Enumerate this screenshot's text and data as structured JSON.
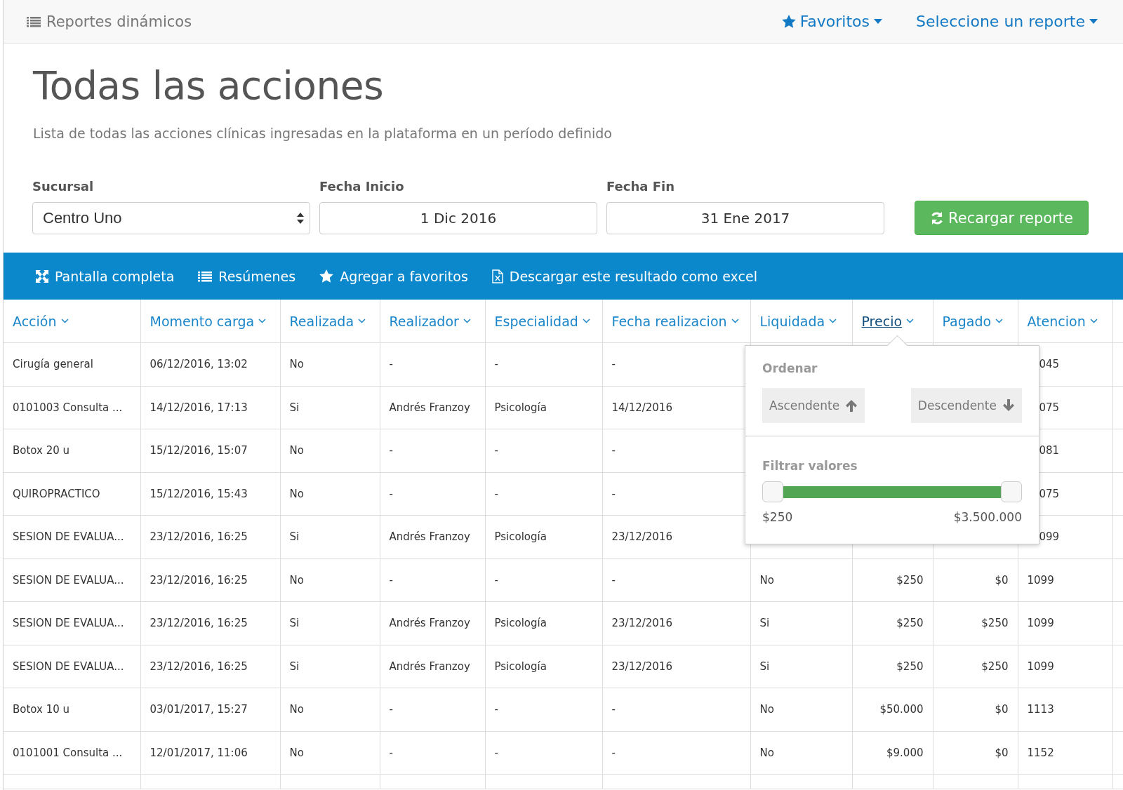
{
  "topbar": {
    "title": "Reportes dinámicos",
    "menus": [
      {
        "kind": "favorites",
        "label": "Favoritos"
      },
      {
        "kind": "reports",
        "label": "Seleccione un reporte"
      }
    ]
  },
  "header": {
    "title": "Todas las acciones",
    "subtitle": "Lista de todas las acciones clínicas ingresadas en la plataforma en un período definido"
  },
  "filters": [
    {
      "kind": "select",
      "label": "Sucursal",
      "value": "Centro Uno"
    },
    {
      "kind": "date",
      "label": "Fecha Inicio",
      "value": "1 Dic 2016"
    },
    {
      "kind": "date",
      "label": "Fecha Fin",
      "value": "31 Ene 2017"
    }
  ],
  "reload_button": "Recargar reporte",
  "toolbar": [
    {
      "kind": "fullscreen",
      "label": "Pantalla completa"
    },
    {
      "kind": "list",
      "label": "Resúmenes"
    },
    {
      "kind": "star",
      "label": "Agregar a favoritos"
    },
    {
      "kind": "excel",
      "label": "Descargar este resultado como excel"
    }
  ],
  "table": {
    "columns": [
      {
        "kind": "text",
        "label": "Acción",
        "selected": false
      },
      {
        "kind": "text",
        "label": "Momento carga",
        "selected": false
      },
      {
        "kind": "text",
        "label": "Realizada",
        "selected": false
      },
      {
        "kind": "text",
        "label": "Realizador",
        "selected": false
      },
      {
        "kind": "text",
        "label": "Especialidad",
        "selected": false
      },
      {
        "kind": "text",
        "label": "Fecha realizacion",
        "selected": false
      },
      {
        "kind": "text",
        "label": "Liquidada",
        "selected": false
      },
      {
        "kind": "money",
        "label": "Precio",
        "selected": true
      },
      {
        "kind": "money",
        "label": "Pagado",
        "selected": false
      },
      {
        "kind": "text",
        "label": "Atencion",
        "selected": false
      }
    ],
    "rows": [
      {
        "kind": "covered",
        "cells": [
          "Cirugía general",
          "06/12/2016, 13:02",
          "No",
          "-",
          "-",
          "-",
          "045"
        ]
      },
      {
        "kind": "covered",
        "cells": [
          "0101003 Consulta ...",
          "14/12/2016, 17:13",
          "Si",
          "Andrés Franzoy",
          "Psicología",
          "14/12/2016",
          "075"
        ]
      },
      {
        "kind": "covered",
        "cells": [
          "Botox 20 u",
          "15/12/2016, 15:07",
          "No",
          "-",
          "-",
          "-",
          "081"
        ]
      },
      {
        "kind": "covered",
        "cells": [
          "QUIROPRACTICO",
          "15/12/2016, 15:43",
          "No",
          "-",
          "-",
          "-",
          "075"
        ]
      },
      {
        "kind": "covered",
        "cells": [
          "SESION DE EVALUA...",
          "23/12/2016, 16:25",
          "Si",
          "Andrés Franzoy",
          "Psicología",
          "23/12/2016",
          "099"
        ]
      },
      {
        "kind": "full",
        "cells": [
          "SESION DE EVALUA...",
          "23/12/2016, 16:25",
          "No",
          "-",
          "-",
          "-",
          "No",
          "$250",
          "$0",
          "1099"
        ]
      },
      {
        "kind": "full",
        "cells": [
          "SESION DE EVALUA...",
          "23/12/2016, 16:25",
          "Si",
          "Andrés Franzoy",
          "Psicología",
          "23/12/2016",
          "Si",
          "$250",
          "$250",
          "1099"
        ]
      },
      {
        "kind": "full",
        "cells": [
          "SESION DE EVALUA...",
          "23/12/2016, 16:25",
          "Si",
          "Andrés Franzoy",
          "Psicología",
          "23/12/2016",
          "Si",
          "$250",
          "$250",
          "1099"
        ]
      },
      {
        "kind": "full",
        "cells": [
          "Botox 10 u",
          "03/01/2017, 15:27",
          "No",
          "-",
          "-",
          "-",
          "No",
          "$50.000",
          "$0",
          "1113"
        ]
      },
      {
        "kind": "full",
        "cells": [
          "0101001 Consulta ...",
          "12/01/2017, 11:06",
          "No",
          "-",
          "-",
          "-",
          "No",
          "$9.000",
          "$0",
          "1152"
        ]
      }
    ]
  },
  "popup": {
    "sort_title": "Ordenar",
    "sort_buttons": [
      {
        "kind": "asc",
        "label": "Ascendente"
      },
      {
        "kind": "desc",
        "label": "Descendente"
      }
    ],
    "filter_title": "Filtrar valores",
    "range": {
      "thumbs": [
        {
          "level": 0
        },
        {
          "level": 1
        }
      ],
      "min_label": "$250",
      "max_label": "$3.500.000"
    }
  }
}
